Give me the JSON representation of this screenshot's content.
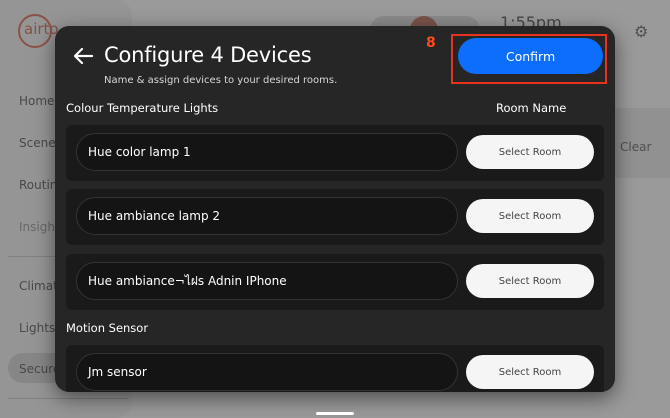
{
  "background": {
    "logo_text": "airto",
    "nav_items": [
      "Home",
      "Scenes",
      "Routine",
      "Insight",
      "Climate",
      "Lights",
      "Secure"
    ],
    "time": "1:55pm",
    "clear_label": "Clear"
  },
  "modal": {
    "title": "Configure 4 Devices",
    "subtitle": "Name & assign devices to your desired rooms.",
    "step_badge": "8",
    "confirm_label": "Confirm",
    "room_column_header": "Room Name",
    "sections": [
      {
        "header": "Colour Temperature Lights",
        "devices": [
          {
            "name": "Hue color lamp 1",
            "room_button": "Select Room"
          },
          {
            "name": "Hue ambiance lamp 2",
            "room_button": "Select Room"
          },
          {
            "name": "Hue ambiance¬ไฝs Adnin IPhone",
            "room_button": "Select Room"
          }
        ]
      },
      {
        "header": "Motion Sensor",
        "devices": [
          {
            "name": "Jm sensor",
            "room_button": "Select Room"
          }
        ]
      }
    ]
  },
  "colors": {
    "accent": "#0d6efd",
    "highlight": "#e8321b",
    "modal_bg": "#262626"
  }
}
